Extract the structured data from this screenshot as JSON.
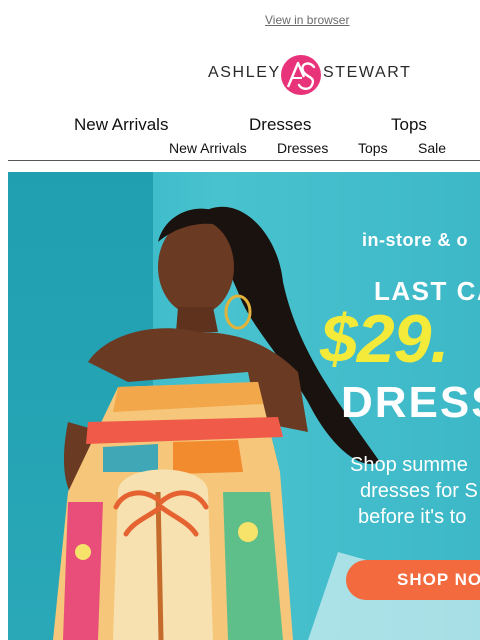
{
  "header": {
    "view_in_browser": "View in browser",
    "logo_left": "ASHLEY",
    "logo_right": "STEWART"
  },
  "nav_primary": [
    {
      "label": "New Arrivals"
    },
    {
      "label": "Dresses"
    },
    {
      "label": "Tops"
    }
  ],
  "nav_secondary": [
    {
      "label": "New Arrivals"
    },
    {
      "label": "Dresses"
    },
    {
      "label": "Tops"
    },
    {
      "label": "Sale"
    }
  ],
  "hero": {
    "line_store": "in-store & o",
    "line_last": "LAST CA",
    "price": "$29.",
    "line_dress": "DRESS",
    "sub1": "Shop summe",
    "sub2": "dresses for S",
    "sub3": "before it's to",
    "cta": "SHOP NO"
  },
  "colors": {
    "brand_pink": "#e8337a",
    "hero_teal": "#49c2cf",
    "price_yellow": "#f4ea3a",
    "cta_orange": "#f26a3d"
  }
}
